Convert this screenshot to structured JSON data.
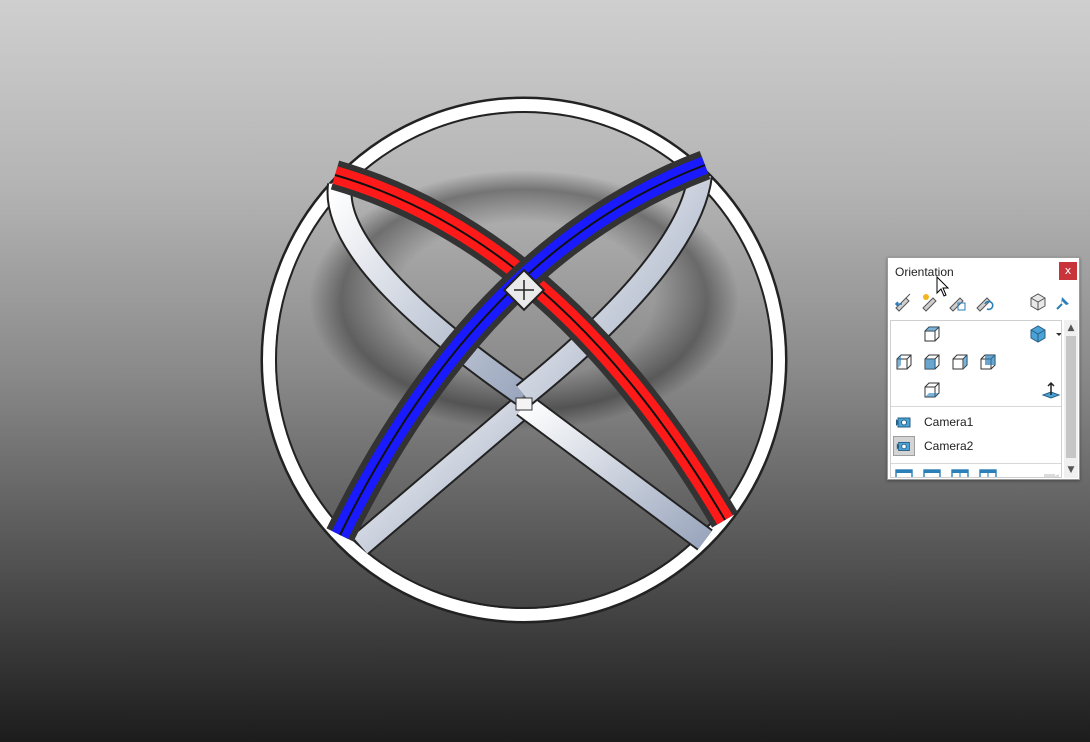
{
  "orientation_dialog": {
    "title": "Orientation",
    "close_label": "x",
    "toolbar": [
      {
        "name": "new-view-icon"
      },
      {
        "name": "update-standard-views-icon"
      },
      {
        "name": "reset-standard-views-icon"
      },
      {
        "name": "link-views-icon"
      },
      {
        "name": "view-selector-icon"
      },
      {
        "name": "pin-icon"
      }
    ],
    "standard_views": [
      {
        "name": "top-view"
      },
      {
        "name": "left-view"
      },
      {
        "name": "front-view"
      },
      {
        "name": "right-view"
      },
      {
        "name": "back-view"
      },
      {
        "name": "bottom-view"
      },
      {
        "name": "isometric-view"
      },
      {
        "name": "normal-to-view"
      }
    ],
    "cameras": [
      {
        "label": "Camera1",
        "selected": false
      },
      {
        "label": "Camera2",
        "selected": true
      }
    ],
    "viewport_views": [
      {
        "name": "single-view"
      },
      {
        "name": "two-view-horizontal"
      },
      {
        "name": "two-view-vertical"
      },
      {
        "name": "four-view"
      }
    ],
    "colors": {
      "icon_blue": "#2a7fb8",
      "close_red": "#c8343a",
      "ring_red": "#ff1a1a",
      "ring_blue": "#1a1aff"
    }
  }
}
